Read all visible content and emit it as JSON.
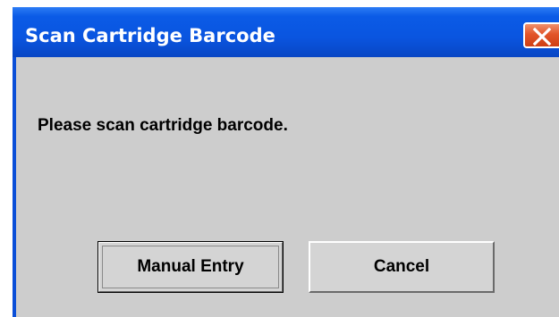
{
  "dialog": {
    "title": "Scan Cartridge Barcode",
    "message": "Please scan cartridge barcode.",
    "buttons": {
      "manual_entry": "Manual Entry",
      "cancel": "Cancel"
    },
    "close_icon": "close-icon"
  },
  "colors": {
    "titlebar": "#0a55e0",
    "client_background": "#cdcdcd",
    "close_button": "#e2552a",
    "title_text": "#ffffff"
  }
}
